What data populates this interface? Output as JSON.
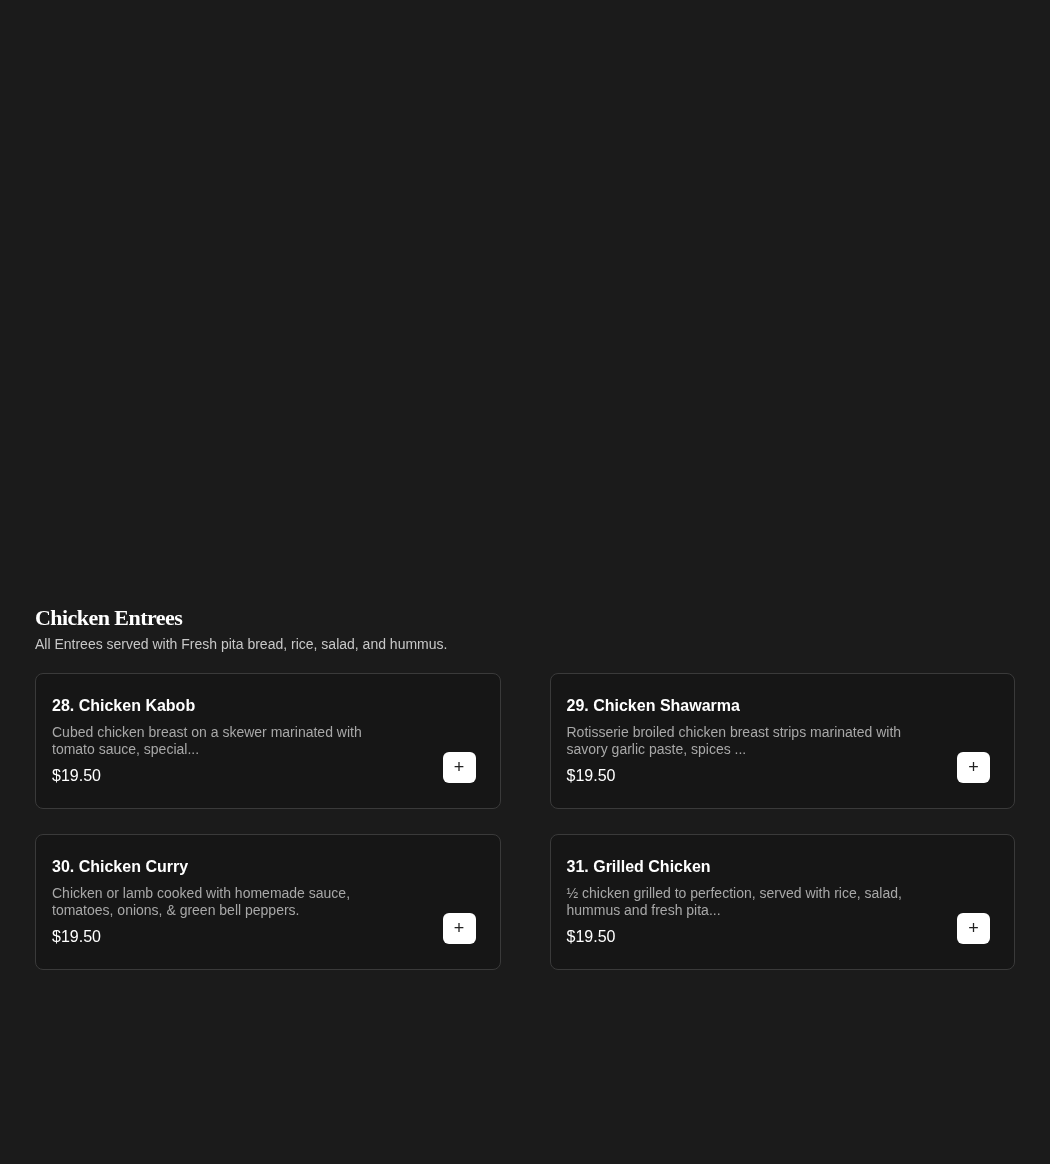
{
  "section": {
    "title": "Chicken Entrees",
    "subtitle": "All Entrees served with Fresh pita bread, rice, salad, and hummus."
  },
  "items": [
    {
      "name": "28. Chicken Kabob",
      "description": "Cubed chicken breast on a skewer marinated with tomato sauce, special...",
      "price": "$19.50",
      "button": "+"
    },
    {
      "name": "29. Chicken Shawarma",
      "description": "Rotisserie broiled chicken breast strips marinated with savory garlic paste, spices ...",
      "price": "$19.50",
      "button": "+"
    },
    {
      "name": "30. Chicken Curry",
      "description": "Chicken or lamb cooked with homemade sauce, tomatoes, onions, & green bell peppers.",
      "price": "$19.50",
      "button": "+"
    },
    {
      "name": "31. Grilled Chicken",
      "description": "½ chicken grilled to perfection, served with rice, salad, hummus and fresh pita...",
      "price": "$19.50",
      "button": "+"
    }
  ]
}
